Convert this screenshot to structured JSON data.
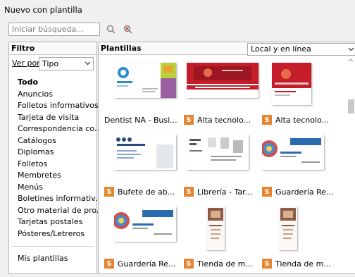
{
  "window": {
    "title": "Nuevo con plantilla"
  },
  "search": {
    "placeholder": "Iniciar búsqueda..."
  },
  "filter": {
    "header": "Filtro",
    "ver_por_label": "Ver por:",
    "type_value": "Tipo",
    "categories": [
      "Todo",
      "Anuncios",
      "Folletos informativos",
      "Tarjeta de visita",
      "Correspondencia co...",
      "Catálogos",
      "Diplomas",
      "Folletos",
      "Membretes",
      "Menús",
      "Boletines informativ...",
      "Otro material de pro...",
      "Tarjetas postales",
      "Pósteres/Letreros"
    ],
    "mis_plantillas": "Mis plantillas"
  },
  "templates": {
    "header": "Plantillas",
    "location_value": "Local y en línea",
    "items": [
      {
        "label": "Dentist NA - Busi...",
        "badge": ""
      },
      {
        "label": "Alta tecnolo...",
        "badge": "S"
      },
      {
        "label": "Alta tecnolo...",
        "badge": "S"
      },
      {
        "label": "Bufete de ab...",
        "badge": "S"
      },
      {
        "label": "Librería - Tar...",
        "badge": "S"
      },
      {
        "label": "Guardería Re...",
        "badge": "S"
      },
      {
        "label": "Guardería Re...",
        "badge": "S"
      },
      {
        "label": "Tienda de m...",
        "badge": "S"
      },
      {
        "label": "Tienda de m...",
        "badge": "S"
      }
    ]
  }
}
